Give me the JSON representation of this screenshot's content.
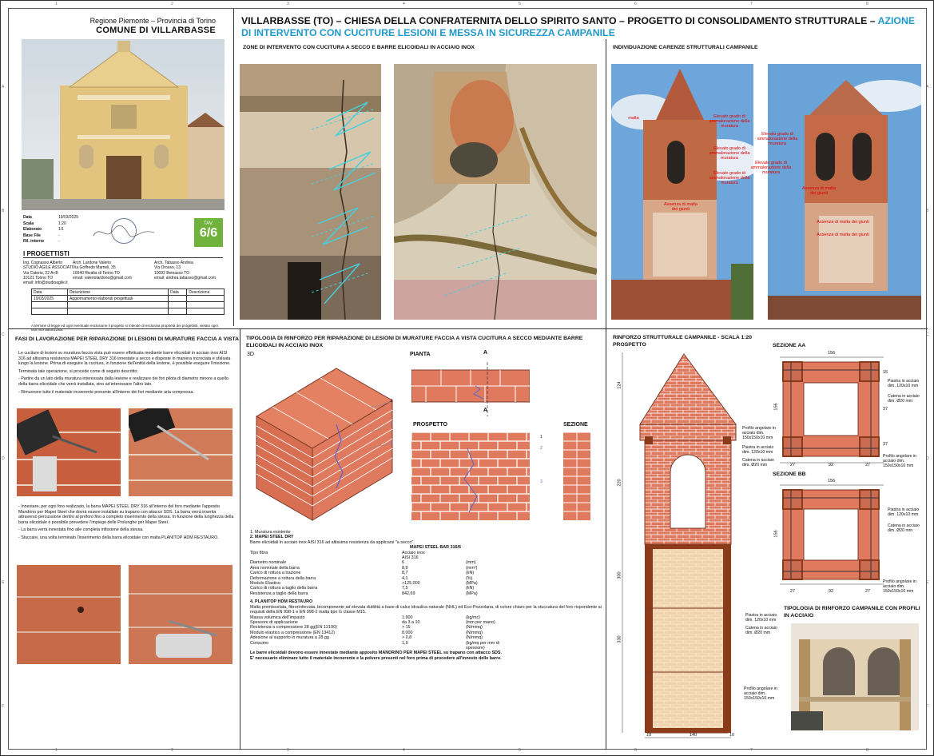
{
  "ruler": {
    "top": [
      "1",
      "2",
      "3",
      "4",
      "5",
      "6",
      "7",
      "8"
    ],
    "side": [
      "A",
      "B",
      "C",
      "D",
      "E",
      "F"
    ]
  },
  "title_block": {
    "region": "Regione Piemonte – Provincia di Torino",
    "comune": "COMUNE DI VILLARBASSE",
    "meta": [
      {
        "label": "Data",
        "value": "19/03/2025"
      },
      {
        "label": "Scala",
        "value": "1:20"
      },
      {
        "label": "Elaborato",
        "value": "1/1"
      },
      {
        "label": "Base File",
        "value": "-"
      },
      {
        "label": "Ril. interno",
        "value": "-"
      }
    ],
    "tav_label": "TAV.",
    "tav_number": "6/6",
    "progettisti_title": "I PROGETTISTI",
    "col1": [
      "Ing. Cognasso Alberto",
      "STUDIO AGILE ASSOCIATI",
      "Via Cateria, 22 A+B",
      "10121 Torino TO",
      "email: info@studioagile.it"
    ],
    "col2": [
      "Arch. Lardone Valerio",
      "Via Goffredo Mameli, 35",
      "10040 Rivalta di Torino TO",
      "email: valeriolardone@gmail.com"
    ],
    "col3": [
      "Arch. Tabasso Andrea",
      "Via Orosso, 13",
      "10092 Beinasco TO",
      "email: andrea.tabasso@gmail.com"
    ],
    "table_head": [
      "Data",
      "Descrizione",
      "Data",
      "Descrizione"
    ],
    "table_row1": [
      "19/03/2025",
      "Aggiornamento elaborati progettuali",
      "",
      ""
    ],
    "note": "A termine di legge ed ogni eventuale esclusione il progetto si intende di esclusiva proprietà dei progettisti, vietato ogni uso non autorizzato."
  },
  "header": {
    "title_black": "VILLARBASSE (TO) – CHIESA DELLA CONFRATERNITA DELLO SPIRITO SANTO – PROGETTO DI CONSOLIDAMENTO STRUTTURALE –",
    "title_accent": "AZIONE DI INTERVENTO CON CUCITURE LESIONI E MESSA IN SICUREZZA CAMPANILE"
  },
  "sections": {
    "zone_title": "ZONE DI INTERVENTO CON CUCITURA A SECCO E BARRE ELICOIDALI IN ACCIAIO INOX",
    "carenze_title": "INDIVIDUAZIONE CARENZE STRUTTURALI CAMPANILE",
    "fasi_title": "FASI DI LAVORAZIONE PER RIPARAZIONE DI LESIONI DI MURATURE FACCIA A VISTA",
    "tipologia_title": "TIPOLOGIA DI RINFORZO PER RIPARAZIONE DI LESIONI DI MURATURE FACCIA A VISTA CUCITURA A SECCO MEDIANTE BARRE ELICOIDALI IN ACCIAIO INOX",
    "rinforzo_title": "RINFORZO STRUTTURALE CAMPANILE - SCALA 1:20",
    "prospetto": "PROSPETTO",
    "sezione_aa": "SEZIONE AA",
    "sezione_bb": "SEZIONE BB",
    "tip_campanile": "TIPOLOGIA DI RINFORZO CAMPANILE CON PROFILI IN ACCIAIO",
    "label_3d": "3D",
    "label_pianta": "PIANTA",
    "label_prospetto": "PROSPETTO",
    "label_sezione": "SEZIONE",
    "section_mark": "A"
  },
  "red_labels": {
    "l1": "Elevato grado di ammalorazione della muratura",
    "l2": "Elevato grado di ammalorazione della muratura",
    "l3": "Elevato grado di ammalorazione della muratura",
    "l4": "Elevato grado di ammalorazione della muratura",
    "l5": "Assenza di malta dei giunti",
    "l6": "Elevato grado di ammalorazione della muratura",
    "l7": "Elevato grado di ammalorazione della muratura",
    "l8": "Assenza di malta dei giunti",
    "l9": "Assenza di malta dei giunti",
    "l10": "Assenza di malta dei giunti",
    "l11": "malta"
  },
  "fasi": {
    "p1": "Le cuciture di lesioni su muratura faccia vista può essere effettuata mediante barre elicoidali in acciaio inox AISI 316 ad altissima resistenza MAPEI STEEL DRY 316 innestate a secco e disposte in maniera incrociata e sfalsata lungo la lesione. Prima di eseguire la cucitura, in funzione dell'entità della lesione, è possibile eseguire l'iniezione.",
    "p2": "Terminata tale operazione, si procede come di seguito descritto:",
    "p3": "- Partire da un lato della muratura interessata dalla lesione e realizzare dei fori pilota di diametro minore a quello della barra elicoidale che verrà installata, sino ad interessare l'altro lato.",
    "p4": "- Rimuovere tutto il materiale incoerente presente all'interno dei fori mediante aria compressa.",
    "p5": "- Innestare, per ogni foro realizzato, la barra MAPEI STEEL DRY 316 all'interno del foro mediante l'apposito Mandrino per Mapei Steel che dovrà essere installato su trapano con attacco SDS. La barra verrà inserita attraverso percussione dentro al preforo fino a completo inserimento della stessa. In funzione della lunghezza della barra elicoidale è possibile prevedere l'impiego delle Prolunghe per Mapei Steel.",
    "p6": "- La barra verrà innestata fino alle completa infissione della stessa.",
    "p7": "- Stuccare, una volta terminato l'inserimento della barra elicoidale con malta PLANITOP HDM RESTAURO."
  },
  "tech": {
    "item1": "1.  Muratura esistente",
    "item2": "2.  MAPEI STEEL DRY",
    "item2_desc": "Barre elicoidali in acciaio inox AISI 316 ad altissima resistenza da applicarsi \"a secco\".",
    "bar_name": "MAPEI STEEL BAR 316/6",
    "rows": [
      {
        "k": "Tipo fibra",
        "v": "Acciaio inox",
        "u": ""
      },
      {
        "k": "",
        "v": "AISI 316",
        "u": ""
      },
      {
        "k": "Diametro nominale",
        "v": "6",
        "u": "(mm)"
      },
      {
        "k": "Area nominale della barra",
        "v": "8,9",
        "u": "(mm²)"
      },
      {
        "k": "Carico di rottura a trazione",
        "v": "8,7",
        "u": "(kN)"
      },
      {
        "k": "Deformazione a rottura della barra",
        "v": "4,1",
        "u": "(%)"
      },
      {
        "k": "Modulo Elastico",
        "v": ">125.000",
        "u": "(MPa)"
      },
      {
        "k": "Carico di rottura a taglio della barra",
        "v": "7,5",
        "u": "(kN)"
      },
      {
        "k": "Resistenza a taglio della barra",
        "v": "842,69",
        "u": "(MPa)"
      }
    ],
    "item4": "4.  PLANITOP HDM RESTAURO",
    "item4_desc": "Malta premiscelata, fibrorinforzata, bicomponente ad elevata duttilità a base di calce idraulica naturale (NHL) ed Eco-Pozzolana, di colore chiaro per la stuccatura del foro rispondente ai requisiti della EN 998-1 e EN 998-2 malta tipo G classe M15.",
    "rows2": [
      {
        "k": "Massa volumica dell'impasto",
        "v": "1.900",
        "u": "(kg/mc)"
      },
      {
        "k": "Spessore di applicazione",
        "v": "da 3 a 10",
        "u": "(mm per mano)"
      },
      {
        "k": "Resistenza a compressione 28 gg(EN 12190)",
        "v": "> 15",
        "u": "(N/mmq)"
      },
      {
        "k": "Modulo elastico a compressione (EN 13412)",
        "v": "8.000",
        "u": "(N/mmq)"
      },
      {
        "k": "Adesione al supporto in muratura a 28 gg",
        "v": "> 0,8",
        "u": "(N/mmq)"
      },
      {
        "k": "Consumo",
        "v": "1,9",
        "u": "(kg/mq per mm di spessore)"
      }
    ],
    "final": "Le barre elicoidali devono essere innestate mediante apposito MANDRINO PER MAPEI STEEL su trapano con attacco SDS.",
    "final2": "E' necessario eliminare tutto il materiale incoerente e la polvere presenti nel foro prima di procedere all'innesto delle barre."
  },
  "tower_labels": {
    "profilo1": "Profilo angolare in acciaio dim. 150x150x10 mm",
    "piastra1": "Piastra in acciaio dim. 120x10 mm",
    "catena1": "Catena in acciaio dim. Ø20 mm",
    "piastra2": "Piastra in acciaio dim. 120x10 mm",
    "catena2": "Catena in acciaio dim. Ø20 mm",
    "profilo2": "Profilo angolare in acciaio dim. 150x150x10 mm",
    "dim_124": "124",
    "dim_220": "220",
    "dim_300": "300",
    "dim_330": "330",
    "dim_b1": "10",
    "dim_b2": "140",
    "dim_b3": "10"
  },
  "section_labels": {
    "aa_top": "156",
    "aa_side": "156",
    "aa_b": [
      "27",
      "92",
      "27"
    ],
    "aa_r": [
      "15",
      "37",
      "37"
    ],
    "aa_piastra": "Piastra in acciaio dim. 120x10 mm",
    "aa_catena": "Catena in acciaio dim. Ø20 mm",
    "aa_profilo": "Profilo angolare in acciaio dim. 150x150x10 mm",
    "bb_top": "156",
    "bb_side": "156",
    "bb_b": [
      "27",
      "92",
      "27"
    ],
    "bb_piastra": "Piastra in acciaio dim. 120x10 mm",
    "bb_catena": "Catena in acciaio dim. Ø20 mm",
    "bb_profilo": "Profilo angolare in acciaio dim. 150x150x10 mm"
  },
  "callouts": [
    "1",
    "2",
    "3"
  ],
  "colors": {
    "accent": "#2299cc",
    "brick": "#e07a5f",
    "mortar": "#ffffff",
    "red": "#e00000",
    "tav": "#6fb33c",
    "steel": "#8b3a1a"
  }
}
